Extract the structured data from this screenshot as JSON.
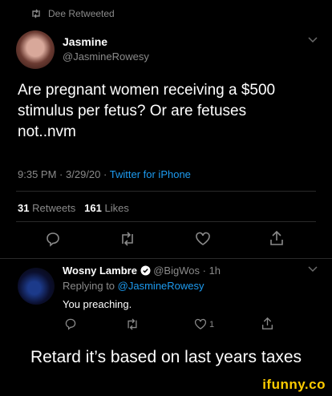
{
  "retweet_banner": {
    "text": "Dee Retweeted"
  },
  "tweet": {
    "author_name": "Jasmine",
    "author_handle": "@JasmineRowesy",
    "text": "Are pregnant women receiving a $500 stimulus per fetus? Or are fetuses not..nvm",
    "time": "9:35 PM",
    "date": "3/29/20",
    "separator": "·",
    "source": "Twitter for iPhone",
    "retweets_count": "31",
    "retweets_label": "Retweets",
    "likes_count": "161",
    "likes_label": "Likes"
  },
  "reply": {
    "author_name": "Wosny Lambre",
    "author_handle": "@BigWos",
    "separator": "·",
    "time_ago": "1h",
    "replying_prefix": "Replying to",
    "replying_handle": "@JasmineRowesy",
    "text": "You preaching.",
    "like_count": "1"
  },
  "caption": "Retard it’s based on last years taxes",
  "watermark": "ifunny.co",
  "colors": {
    "accent": "#1d9bf0",
    "background": "#000000",
    "muted": "#8a8a8a",
    "watermark": "#ffcc00"
  },
  "icons": [
    "retweet-icon",
    "chevron-down-icon",
    "reply-icon",
    "heart-icon",
    "share-icon",
    "verified-icon"
  ]
}
